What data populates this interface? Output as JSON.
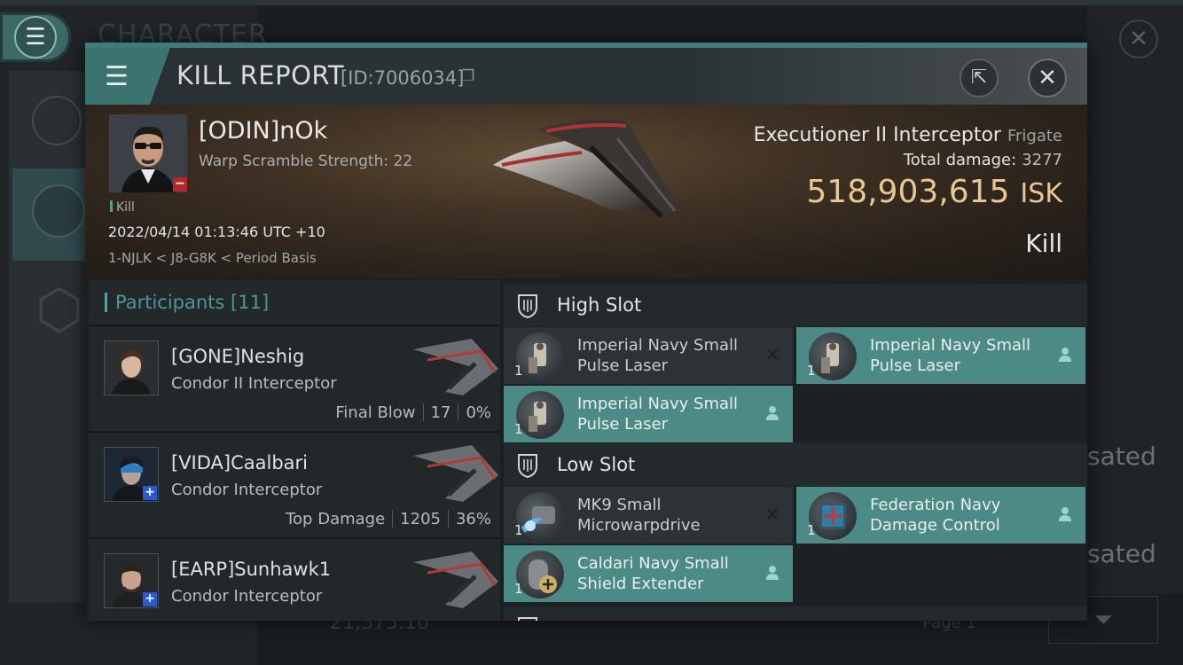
{
  "background": {
    "character_title": "CHARACTER",
    "right_text_1": "sated",
    "right_text_2": "sated",
    "wallet": "21,375.10",
    "page_label": "Page 1"
  },
  "modal": {
    "title": "KILL REPORT",
    "id_label": "[ID:7006034]"
  },
  "victim": {
    "name": "[ODIN]nOk",
    "warp_scramble": "Warp Scramble Strength: 22",
    "kill_tag": "Kill",
    "datetime": "2022/04/14 01:13:46 UTC +10",
    "location": "1-NJLK < J8-G8K < Period Basis",
    "ship_name": "Executioner II Interceptor",
    "ship_class": "Frigate",
    "total_damage_label": "Total damage:",
    "total_damage": "3277",
    "isk_value": "518,903,615",
    "isk_unit": "ISK",
    "result": "Kill"
  },
  "participants": {
    "title": "Participants",
    "count": "[11]",
    "items": [
      {
        "name": "[GONE]Neshig",
        "ship": "Condor II Interceptor",
        "tag": "Final Blow",
        "damage": "17",
        "percent": "0%"
      },
      {
        "name": "[VIDA]Caalbari",
        "ship": "Condor Interceptor",
        "tag": "Top Damage",
        "damage": "1205",
        "percent": "36%"
      },
      {
        "name": "[EARP]Sunhawk1",
        "ship": "Condor Interceptor"
      }
    ]
  },
  "slots": {
    "high": {
      "title": "High Slot",
      "modules": [
        {
          "name": "Imperial Navy Small Pulse Laser",
          "qty": "1",
          "state": "destroyed"
        },
        {
          "name": "Imperial Navy Small Pulse Laser",
          "qty": "1",
          "state": "dropped"
        },
        {
          "name": "Imperial Navy Small Pulse Laser",
          "qty": "1",
          "state": "dropped"
        }
      ]
    },
    "low": {
      "title": "Low Slot",
      "modules": [
        {
          "name": "MK9 Small Microwarpdrive",
          "qty": "1",
          "state": "destroyed"
        },
        {
          "name": "Federation Navy Damage Control",
          "qty": "1",
          "state": "dropped"
        },
        {
          "name": "Caldari Navy Small Shield Extender",
          "qty": "1",
          "state": "dropped"
        }
      ]
    },
    "mid_partial_label": ""
  },
  "colors": {
    "accent": "#3f7c7c",
    "dropped_row": "#4c8a86",
    "destroyed_row": "#2c3236",
    "isk_gold": "#e9c791",
    "plus_badge": "#2a58d8",
    "minus_badge": "#b8282a"
  },
  "icons": [
    "menu-icon",
    "copy-icon",
    "share-icon",
    "close-icon",
    "shield-slot-icon",
    "person-icon",
    "cross-icon",
    "filter-icon",
    "star-icon",
    "crossed-swords-icon"
  ]
}
